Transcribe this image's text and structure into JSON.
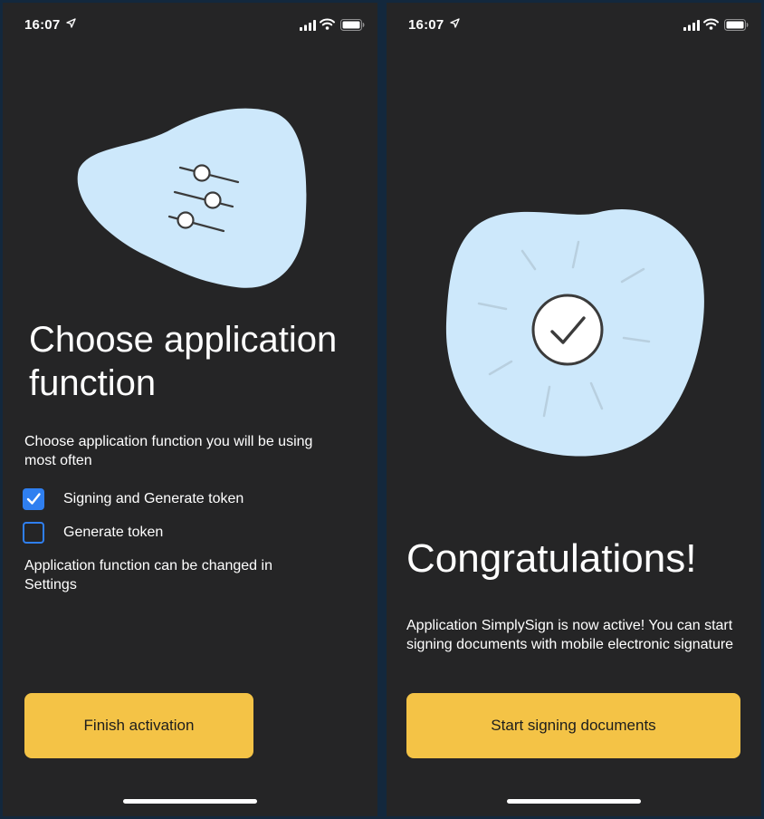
{
  "screens": [
    {
      "status_bar": {
        "time": "16:07"
      },
      "title": "Choose application function",
      "subtitle": "Choose application function you will be using most often",
      "options": [
        {
          "label": "Signing and Generate token",
          "checked": true
        },
        {
          "label": "Generate token",
          "checked": false
        }
      ],
      "note": "Application function can be changed in Settings",
      "button_label": "Finish activation",
      "illustration": "sliders-icon"
    },
    {
      "status_bar": {
        "time": "16:07"
      },
      "title": "Congratulations!",
      "body": "Application SimplySign is now active! You can start signing documents with mobile electronic signature",
      "button_label": "Start signing documents",
      "illustration": "checkmark-circle-icon"
    }
  ],
  "colors": {
    "background": "#252526",
    "outer": "#13283d",
    "accent_button": "#f4c346",
    "checkbox": "#2f7ff0",
    "blob": "#cde8fb",
    "text": "#ffffff"
  },
  "icons": [
    "location-arrow-icon",
    "signal-icon",
    "wifi-icon",
    "battery-icon",
    "checkmark-icon"
  ]
}
